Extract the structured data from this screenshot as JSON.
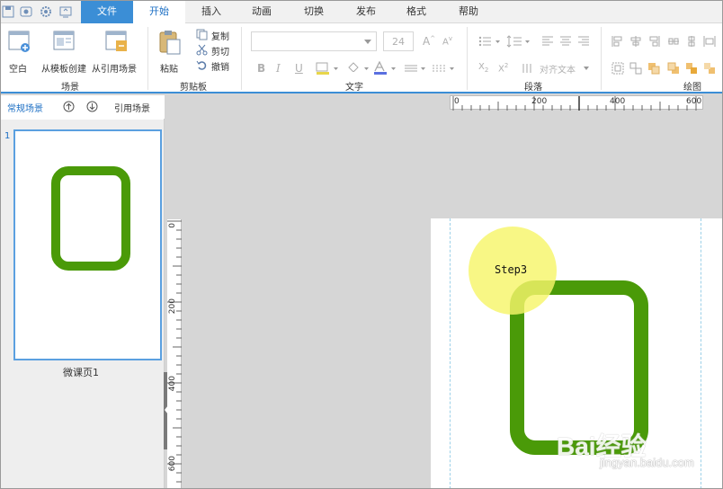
{
  "tabs": [
    {
      "label": "文件"
    },
    {
      "label": "开始"
    },
    {
      "label": "插入"
    },
    {
      "label": "动画"
    },
    {
      "label": "切换"
    },
    {
      "label": "发布"
    },
    {
      "label": "格式"
    },
    {
      "label": "帮助"
    }
  ],
  "ribbon": {
    "scene_group": {
      "label": "场景",
      "blank": "空白",
      "from_template": "从模板创建",
      "from_ref": "从引用场景"
    },
    "clipboard_group": {
      "label": "剪贴板",
      "paste": "粘贴",
      "copy": "复制",
      "cut": "剪切",
      "undo": "撤销"
    },
    "text_group": {
      "label": "文字",
      "font_size": "24",
      "bold": "B",
      "italic": "I",
      "underline": "U"
    },
    "para_group": {
      "label": "段落",
      "align_text": "对齐文本"
    },
    "draw_group": {
      "label": "绘图"
    }
  },
  "scene_panel": {
    "tab_normal": "常规场景",
    "tab_ref": "引用场景",
    "slide_number": "1",
    "slide_name": "微课页1"
  },
  "ruler": {
    "h_ticks": [
      "0",
      "200",
      "400",
      "600"
    ],
    "v_ticks": [
      "0",
      "200",
      "400",
      "600"
    ]
  },
  "canvas": {
    "callout_text": "Step3"
  },
  "watermark": {
    "brand": "Bai经验",
    "url": "jingyan.baidu.com"
  },
  "colors": {
    "accent": "#3b8ed6",
    "shape_green": "#4a9a08",
    "callout_yellow": "#f7f56a"
  }
}
